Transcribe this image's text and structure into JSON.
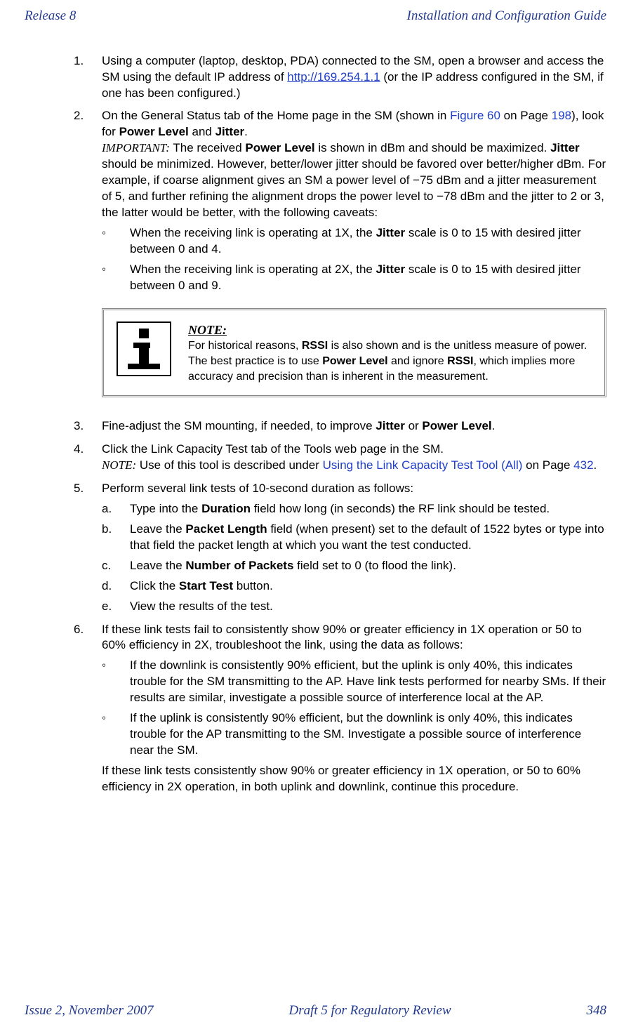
{
  "header": {
    "left": "Release 8",
    "right": "Installation and Configuration Guide"
  },
  "footer": {
    "left": "Issue 2, November 2007",
    "center": "Draft 5 for Regulatory Review",
    "right": "348"
  },
  "steps": {
    "s1": {
      "num": "1.",
      "t1": "Using a computer (laptop, desktop, PDA) connected to the SM, open a browser and access the SM using the default IP address of ",
      "link": "http://169.254.1.1",
      "t2": " (or the IP address configured in the SM, if one has been configured.)"
    },
    "s2": {
      "num": "2.",
      "t1": "On the General Status tab of the Home page in the SM (shown in ",
      "fig": "Figure 60",
      "t2": " on Page ",
      "pg": "198",
      "t3": "), look for ",
      "b1": "Power Level",
      "t4": " and ",
      "b2": "Jitter",
      "t5": ".",
      "imp": "IMPORTANT:",
      "t6": " The received ",
      "b3": "Power Level",
      "t7": " is shown in dBm and should be maximized. ",
      "b4": "Jitter",
      "t8": " should be minimized. However, better/lower jitter should be favored over better/higher dBm. For example, if coarse alignment gives an SM a power level of −75 dBm and a jitter measurement of 5, and further refining the alignment drops the power level to −78 dBm and the jitter to 2 or 3, the latter would be better, with the following caveats:",
      "li1a": "When the receiving link is operating at 1X, the ",
      "li1b": "Jitter",
      "li1c": " scale is 0 to 15 with desired jitter between 0 and 4.",
      "li2a": "When the receiving link is operating at 2X, the ",
      "li2b": "Jitter",
      "li2c": " scale is 0 to 15 with desired jitter between 0 and 9."
    },
    "note": {
      "lead": "NOTE:",
      "t1": "For historical reasons, ",
      "b1": "RSSI",
      "t2": " is also shown and is the unitless measure of power. The best practice is to use ",
      "b2": "Power Level",
      "t3": " and ignore ",
      "b3": "RSSI",
      "t4": ", which implies more accuracy and precision than is inherent in the measurement."
    },
    "s3": {
      "num": "3.",
      "t1": "Fine-adjust the SM mounting, if needed, to improve ",
      "b1": "Jitter",
      "t2": " or ",
      "b2": "Power Level",
      "t3": "."
    },
    "s4": {
      "num": "4.",
      "t1": "Click the Link Capacity Test tab of the Tools web page in the SM.",
      "nlabel": "NOTE:",
      "t2": " Use of this tool is described under ",
      "x1": "Using the Link Capacity Test Tool (All)",
      "t3": " on Page ",
      "pg": "432",
      "t4": "."
    },
    "s5": {
      "num": "5.",
      "t1": "Perform several link tests of 10-second duration as follows:",
      "a": {
        "mk": "a.",
        "t1": "Type into the ",
        "b1": "Duration",
        "t2": " field how long (in seconds) the RF link should be tested."
      },
      "b": {
        "mk": "b.",
        "t1": "Leave the ",
        "b1": "Packet Length",
        "t2": " field (when present) set to the default of 1522 bytes or type into that field the packet length at which you want the test conducted."
      },
      "c": {
        "mk": "c.",
        "t1": "Leave the ",
        "b1": "Number of Packets",
        "t2": " field set to 0 (to flood the link)."
      },
      "d": {
        "mk": "d.",
        "t1": "Click the ",
        "b1": "Start Test",
        "t2": " button."
      },
      "e": {
        "mk": "e.",
        "t1": "View the results of the test."
      }
    },
    "s6": {
      "num": "6.",
      "t1": "If these link tests fail to consistently show 90% or greater efficiency in 1X operation or 50 to 60% efficiency in 2X, troubleshoot the link, using the data as follows:",
      "li1": "If the downlink is consistently 90% efficient, but the uplink is only 40%, this indicates trouble for the SM transmitting to the AP. Have link tests performed for nearby SMs. If their results are similar, investigate a possible source of interference local at the AP.",
      "li2": "If the uplink is consistently 90% efficient, but the downlink is only 40%, this indicates trouble for the AP transmitting to the SM. Investigate a possible source of interference near the SM.",
      "t2": "If these link tests consistently show 90% or greater efficiency in 1X operation, or 50 to 60% efficiency in 2X operation, in both uplink and downlink, continue this procedure."
    }
  },
  "bul": "◦"
}
